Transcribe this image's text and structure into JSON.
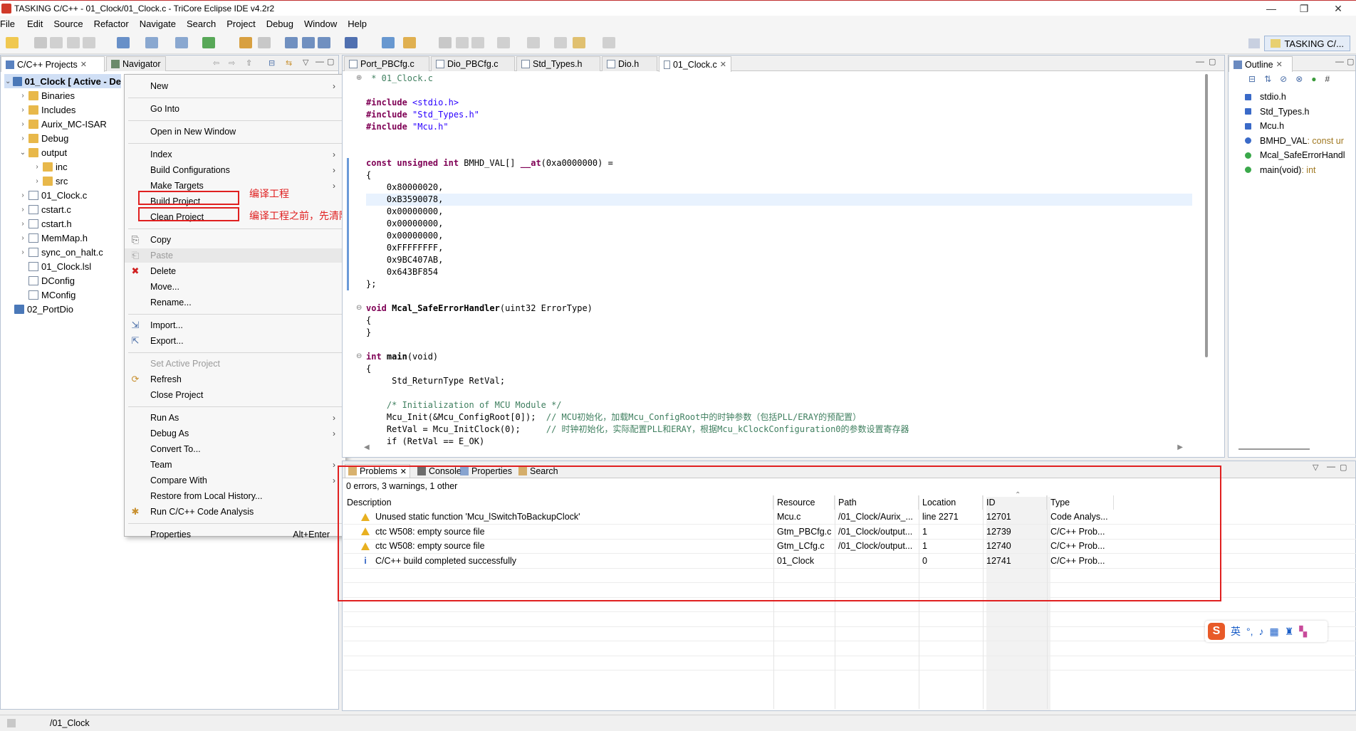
{
  "window": {
    "title": "TASKING C/C++ - 01_Clock/01_Clock.c - TriCore Eclipse IDE v4.2r2",
    "minimize": "—",
    "maximize": "❐",
    "close": "✕"
  },
  "menubar": [
    "File",
    "Edit",
    "Source",
    "Refactor",
    "Navigate",
    "Search",
    "Project",
    "Debug",
    "Window",
    "Help"
  ],
  "perspective": {
    "label": "TASKING C/..."
  },
  "left_panel": {
    "tabs": [
      {
        "label": "C/C++ Projects"
      },
      {
        "label": "Navigator"
      }
    ],
    "tree": [
      {
        "label": "01_Clock [ Active - De",
        "indent": 0,
        "arrow": "⌄",
        "icon": "proj",
        "bold": true
      },
      {
        "label": "Binaries",
        "indent": 1,
        "arrow": "›",
        "icon": "bin"
      },
      {
        "label": "Includes",
        "indent": 1,
        "arrow": "›",
        "icon": "inc"
      },
      {
        "label": "Aurix_MC-ISAR",
        "indent": 1,
        "arrow": "›",
        "icon": "folder"
      },
      {
        "label": "Debug",
        "indent": 1,
        "arrow": "›",
        "icon": "folder"
      },
      {
        "label": "output",
        "indent": 1,
        "arrow": "⌄",
        "icon": "folder"
      },
      {
        "label": "inc",
        "indent": 2,
        "arrow": "›",
        "icon": "folder"
      },
      {
        "label": "src",
        "indent": 2,
        "arrow": "›",
        "icon": "folder"
      },
      {
        "label": "01_Clock.c",
        "indent": 1,
        "arrow": "›",
        "icon": "cfile"
      },
      {
        "label": "cstart.c",
        "indent": 1,
        "arrow": "›",
        "icon": "cfile"
      },
      {
        "label": "cstart.h",
        "indent": 1,
        "arrow": "›",
        "icon": "hfile"
      },
      {
        "label": "MemMap.h",
        "indent": 1,
        "arrow": "›",
        "icon": "hfile"
      },
      {
        "label": "sync_on_halt.c",
        "indent": 1,
        "arrow": "›",
        "icon": "cfile"
      },
      {
        "label": "01_Clock.lsl",
        "indent": 1,
        "arrow": "",
        "icon": "cfile"
      },
      {
        "label": "DConfig",
        "indent": 1,
        "arrow": "",
        "icon": "cfile"
      },
      {
        "label": "MConfig",
        "indent": 1,
        "arrow": "",
        "icon": "cfile"
      },
      {
        "label": "02_PortDio",
        "indent": 0,
        "arrow": "",
        "icon": "proj"
      }
    ]
  },
  "context_menu": {
    "items": [
      {
        "label": "New",
        "sub": true
      },
      {
        "sep": true
      },
      {
        "label": "Go Into"
      },
      {
        "sep": true
      },
      {
        "label": "Open in New Window"
      },
      {
        "sep": true
      },
      {
        "label": "Index",
        "sub": true
      },
      {
        "label": "Build Configurations",
        "sub": true
      },
      {
        "label": "Make Targets",
        "sub": true
      },
      {
        "label": "Build Project"
      },
      {
        "label": "Clean Project"
      },
      {
        "sep": true
      },
      {
        "label": "Copy",
        "icon": "copy"
      },
      {
        "label": "Paste",
        "icon": "paste",
        "disabled": true
      },
      {
        "label": "Delete",
        "icon": "delete"
      },
      {
        "label": "Move..."
      },
      {
        "label": "Rename..."
      },
      {
        "sep": true
      },
      {
        "label": "Import...",
        "icon": "import"
      },
      {
        "label": "Export...",
        "icon": "export"
      },
      {
        "sep": true
      },
      {
        "label": "Set Active Project",
        "disabled": true
      },
      {
        "label": "Refresh",
        "icon": "refresh"
      },
      {
        "label": "Close Project"
      },
      {
        "sep": true
      },
      {
        "label": "Run As",
        "sub": true
      },
      {
        "label": "Debug As",
        "sub": true
      },
      {
        "label": "Convert To..."
      },
      {
        "label": "Team",
        "sub": true
      },
      {
        "label": "Compare With",
        "sub": true
      },
      {
        "label": "Restore from Local History..."
      },
      {
        "label": "Run C/C++ Code Analysis",
        "icon": "analysis"
      },
      {
        "sep": true
      },
      {
        "label": "Properties",
        "accel": "Alt+Enter"
      }
    ],
    "annotations": {
      "build": "编译工程",
      "clean": "编译工程之前，先清除一下"
    }
  },
  "editor": {
    "tabs": [
      {
        "label": "Port_PBCfg.c"
      },
      {
        "label": "Dio_PBCfg.c"
      },
      {
        "label": "Std_Types.h"
      },
      {
        "label": "Dio.h"
      },
      {
        "label": "01_Clock.c",
        "active": true
      }
    ],
    "lines": [
      {
        "parts": [
          {
            "t": " * 01_Clock.c",
            "c": "cm"
          }
        ],
        "fold": "⊕"
      },
      {
        "parts": []
      },
      {
        "parts": [
          {
            "t": "#include ",
            "c": "kw"
          },
          {
            "t": "<stdio.h>",
            "c": "str"
          }
        ]
      },
      {
        "parts": [
          {
            "t": "#include ",
            "c": "kw"
          },
          {
            "t": "\"Std_Types.h\"",
            "c": "str"
          }
        ]
      },
      {
        "parts": [
          {
            "t": "#include ",
            "c": "kw"
          },
          {
            "t": "\"Mcu.h\"",
            "c": "str"
          }
        ]
      },
      {
        "parts": []
      },
      {
        "parts": []
      },
      {
        "parts": [
          {
            "t": "const unsigned int ",
            "c": "kw"
          },
          {
            "t": "BMHD_VAL[] ",
            "c": ""
          },
          {
            "t": "__at",
            "c": "kw"
          },
          {
            "t": "(0xa0000000) =",
            "c": ""
          }
        ]
      },
      {
        "parts": [
          {
            "t": "{",
            "c": ""
          }
        ]
      },
      {
        "parts": [
          {
            "t": "    0x80000020,",
            "c": ""
          }
        ]
      },
      {
        "parts": [
          {
            "t": "    0xB3590078,",
            "c": ""
          }
        ],
        "hl": true
      },
      {
        "parts": [
          {
            "t": "    0x00000000,",
            "c": ""
          }
        ]
      },
      {
        "parts": [
          {
            "t": "    0x00000000,",
            "c": ""
          }
        ]
      },
      {
        "parts": [
          {
            "t": "    0x00000000,",
            "c": ""
          }
        ]
      },
      {
        "parts": [
          {
            "t": "    0xFFFFFFFF,",
            "c": ""
          }
        ]
      },
      {
        "parts": [
          {
            "t": "    0x9BC407AB,",
            "c": ""
          }
        ]
      },
      {
        "parts": [
          {
            "t": "    0x643BF854",
            "c": ""
          }
        ]
      },
      {
        "parts": [
          {
            "t": "};",
            "c": ""
          }
        ]
      },
      {
        "parts": []
      },
      {
        "parts": [
          {
            "t": "void ",
            "c": "kw"
          },
          {
            "t": "Mcal_SafeErrorHandler",
            "c": "b"
          },
          {
            "t": "(uint32 ErrorType)",
            "c": ""
          }
        ],
        "fold": "⊖"
      },
      {
        "parts": [
          {
            "t": "{",
            "c": ""
          }
        ]
      },
      {
        "parts": [
          {
            "t": "}",
            "c": ""
          }
        ]
      },
      {
        "parts": []
      },
      {
        "parts": [
          {
            "t": "int ",
            "c": "kw"
          },
          {
            "t": "main",
            "c": "b"
          },
          {
            "t": "(void)",
            "c": ""
          }
        ],
        "fold": "⊖"
      },
      {
        "parts": [
          {
            "t": "{",
            "c": ""
          }
        ]
      },
      {
        "parts": [
          {
            "t": "     Std_ReturnType RetVal;",
            "c": ""
          }
        ]
      },
      {
        "parts": []
      },
      {
        "parts": [
          {
            "t": "    /* Initialization of MCU Module */",
            "c": "cm"
          }
        ]
      },
      {
        "parts": [
          {
            "t": "    Mcu_Init(&Mcu_ConfigRoot[0]);  ",
            "c": ""
          },
          {
            "t": "// MCU初始化，加载Mcu_ConfigRoot中的时钟参数（包括PLL/ERAY的预配置）",
            "c": "cm"
          }
        ]
      },
      {
        "parts": [
          {
            "t": "    RetVal = Mcu_InitClock(0);     ",
            "c": ""
          },
          {
            "t": "// 时钟初始化，实际配置PLL和ERAY，根据Mcu_kClockConfiguration0的参数设置寄存器",
            "c": "cm"
          }
        ]
      },
      {
        "parts": [
          {
            "t": "    if (RetVal == E_OK)",
            "c": ""
          }
        ]
      }
    ]
  },
  "outline": {
    "tab": "Outline",
    "items": [
      {
        "label": "stdio.h",
        "type": ""
      },
      {
        "label": "Std_Types.h",
        "type": ""
      },
      {
        "label": "Mcu.h",
        "type": ""
      },
      {
        "label": "BMHD_VAL",
        "type": " : const ur"
      },
      {
        "label": "Mcal_SafeErrorHandl",
        "type": ""
      },
      {
        "label": "main(void)",
        "type": " : int"
      }
    ]
  },
  "bottom_panel": {
    "tabs": [
      {
        "label": "Problems",
        "active": true
      },
      {
        "label": "Console"
      },
      {
        "label": "Properties"
      },
      {
        "label": "Search"
      }
    ],
    "summary": "0 errors, 3 warnings, 1 other",
    "columns": [
      "Description",
      "Resource",
      "Path",
      "Location",
      "ID",
      "Type"
    ],
    "rows": [
      {
        "sev": "warn",
        "desc": "Unused static function 'Mcu_lSwitchToBackupClock'",
        "resource": "Mcu.c",
        "path": "/01_Clock/Aurix_...",
        "location": "line 2271",
        "id": "12701",
        "type": "Code Analys..."
      },
      {
        "sev": "warn",
        "desc": "ctc W508: empty source file",
        "resource": "Gtm_PBCfg.c",
        "path": "/01_Clock/output...",
        "location": "1",
        "id": "12739",
        "type": "C/C++ Prob..."
      },
      {
        "sev": "warn",
        "desc": "ctc W508: empty source file",
        "resource": "Gtm_LCfg.c",
        "path": "/01_Clock/output...",
        "location": "1",
        "id": "12740",
        "type": "C/C++ Prob..."
      },
      {
        "sev": "info",
        "desc": "C/C++ build completed successfully",
        "resource": "01_Clock",
        "path": "",
        "location": "0",
        "id": "12741",
        "type": "C/C++ Prob..."
      }
    ]
  },
  "ime": {
    "label": "英"
  },
  "status": {
    "text": "/01_Clock"
  }
}
